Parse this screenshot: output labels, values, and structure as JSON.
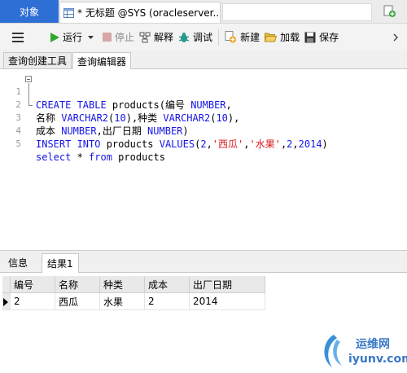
{
  "tabs": {
    "objects": "对象",
    "query_tab": "* 无标题 @SYS (oracleserver..."
  },
  "toolbar": {
    "run": "运行",
    "stop": "停止",
    "explain": "解释",
    "debug": "调试",
    "new": "新建",
    "load": "加载",
    "save": "保存"
  },
  "editor_tabs": [
    "查询创建工具",
    "查询编辑器"
  ],
  "editor": {
    "line_numbers": [
      "1",
      "2",
      "3",
      "4",
      "5"
    ],
    "lines": [
      [
        {
          "t": "CREATE TABLE",
          "c": "kw"
        },
        {
          "t": " products(编号 ",
          "c": ""
        },
        {
          "t": "NUMBER",
          "c": "kw"
        },
        {
          "t": ",",
          "c": ""
        }
      ],
      [
        {
          "t": "名称 ",
          "c": ""
        },
        {
          "t": "VARCHAR2",
          "c": "kw"
        },
        {
          "t": "(",
          "c": ""
        },
        {
          "t": "10",
          "c": "num"
        },
        {
          "t": "),种类 ",
          "c": ""
        },
        {
          "t": "VARCHAR2",
          "c": "kw"
        },
        {
          "t": "(",
          "c": ""
        },
        {
          "t": "10",
          "c": "num"
        },
        {
          "t": "),",
          "c": ""
        }
      ],
      [
        {
          "t": "成本 ",
          "c": ""
        },
        {
          "t": "NUMBER",
          "c": "kw"
        },
        {
          "t": ",出厂日期 ",
          "c": ""
        },
        {
          "t": "NUMBER",
          "c": "kw"
        },
        {
          "t": ")",
          "c": ""
        }
      ],
      [
        {
          "t": "INSERT INTO",
          "c": "kw"
        },
        {
          "t": " products ",
          "c": ""
        },
        {
          "t": "VALUES",
          "c": "kw"
        },
        {
          "t": "(",
          "c": ""
        },
        {
          "t": "2",
          "c": "num"
        },
        {
          "t": ",",
          "c": ""
        },
        {
          "t": "'西瓜'",
          "c": "str"
        },
        {
          "t": ",",
          "c": ""
        },
        {
          "t": "'水果'",
          "c": "str"
        },
        {
          "t": ",",
          "c": ""
        },
        {
          "t": "2",
          "c": "num"
        },
        {
          "t": ",",
          "c": ""
        },
        {
          "t": "2014",
          "c": "num"
        },
        {
          "t": ")",
          "c": ""
        }
      ],
      [
        {
          "t": "select",
          "c": "kw"
        },
        {
          "t": " * ",
          "c": ""
        },
        {
          "t": "from",
          "c": "kw"
        },
        {
          "t": " products",
          "c": ""
        }
      ]
    ]
  },
  "result_tabs": [
    "信息",
    "结果1"
  ],
  "results": {
    "columns": [
      "编号",
      "名称",
      "种类",
      "成本",
      "出厂日期"
    ],
    "rows": [
      [
        "2",
        "西瓜",
        "水果",
        "2",
        "2014"
      ]
    ]
  },
  "watermark": {
    "line1": "运维网",
    "line2": "iyunv.com"
  },
  "colors": {
    "accent": "#2e6fd6",
    "keyword": "#1515e6",
    "string": "#d81b1b"
  }
}
